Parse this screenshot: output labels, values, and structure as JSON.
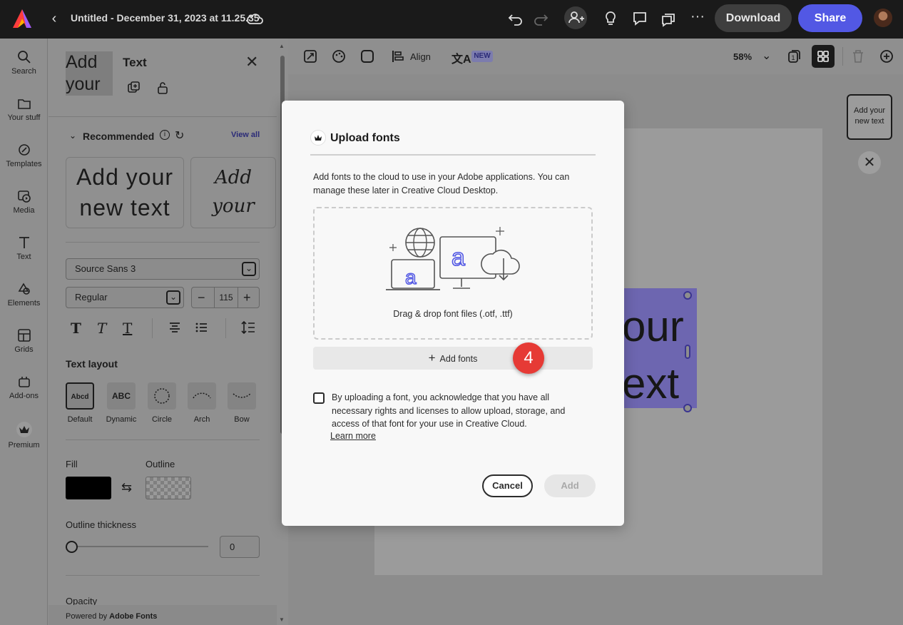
{
  "topbar": {
    "title": "Untitled - December 31, 2023 at 11.25.35",
    "download_label": "Download",
    "share_label": "Share"
  },
  "rail": {
    "items": [
      {
        "label": "Search",
        "icon": "search-icon"
      },
      {
        "label": "Your stuff",
        "icon": "folder-icon"
      },
      {
        "label": "Templates",
        "icon": "templates-icon"
      },
      {
        "label": "Media",
        "icon": "media-icon"
      },
      {
        "label": "Text",
        "icon": "text-icon"
      },
      {
        "label": "Elements",
        "icon": "elements-icon"
      },
      {
        "label": "Grids",
        "icon": "grids-icon"
      },
      {
        "label": "Add-ons",
        "icon": "addons-icon"
      },
      {
        "label": "Premium",
        "icon": "premium-icon"
      }
    ]
  },
  "panel": {
    "preview_text": "Add your new text",
    "title": "Text",
    "recommended_label": "Recommended",
    "view_all_label": "View all",
    "reco_cards": [
      {
        "text": "Add your new text"
      },
      {
        "text": "Add your new text"
      }
    ],
    "font_family": "Source Sans 3",
    "font_weight": "Regular",
    "font_size": "115",
    "text_layout_label": "Text layout",
    "layouts": [
      {
        "tile": "Abcd",
        "label": "Default"
      },
      {
        "tile": "ABC",
        "label": "Dynamic"
      },
      {
        "tile": "",
        "label": "Circle"
      },
      {
        "tile": "",
        "label": "Arch"
      },
      {
        "tile": "",
        "label": "Bow"
      }
    ],
    "fill_label": "Fill",
    "outline_label": "Outline",
    "outline_thickness_label": "Outline thickness",
    "outline_thickness_value": "0",
    "opacity_label": "Opacity",
    "powered_by_prefix": "Powered by ",
    "powered_by_brand": "Adobe Fonts"
  },
  "toolbar": {
    "align_label": "Align",
    "new_badge": "NEW",
    "zoom": "58%"
  },
  "canvas": {
    "selected_text_line1": "our",
    "selected_text_line2": "ext",
    "page_thumb_text": "Add your new text"
  },
  "dialog": {
    "title": "Upload fonts",
    "description": "Add fonts to the cloud to use in your Adobe applications. You can manage these later in Creative Cloud Desktop.",
    "drop_label": "Drag & drop font files (.otf, .ttf)",
    "add_fonts_label": "Add fonts",
    "step_badge": "4",
    "consent_text": "By uploading a font, you acknowledge that you have all necessary rights and licenses to allow upload, storage, and access of that font for your use in Creative Cloud.",
    "learn_more": "Learn more",
    "cancel_label": "Cancel",
    "add_label": "Add",
    "consent_checked": false
  },
  "colors": {
    "accent": "#5258e4",
    "badge": "#e63a35",
    "selection": "#6d66b0"
  }
}
